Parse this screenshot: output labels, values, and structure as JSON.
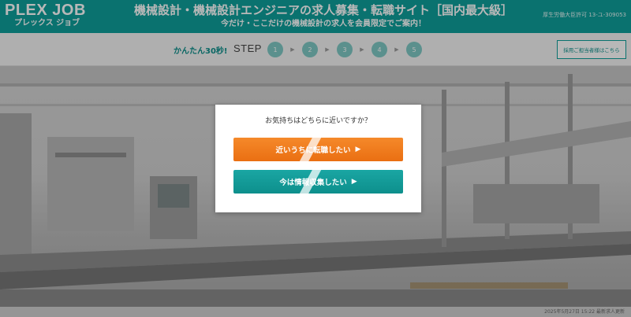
{
  "header": {
    "logo_main": "PLEX JOB",
    "logo_sub": "プレックス ジョブ",
    "title": "機械設計・機械設計エンジニアの求人募集・転職サイト［国内最大級］",
    "subtitle": "今だけ・ここだけの機械設計の求人を会員限定でご案内！",
    "license": "厚生労働大臣許可 13-ユ-309053"
  },
  "stepbar": {
    "lead": "かんたん30秒!",
    "label": "STEP",
    "steps": [
      "1",
      "2",
      "3",
      "4",
      "5"
    ],
    "corporate_button": "採用ご担当者様はこちら"
  },
  "modal": {
    "question": "お気持ちはどちらに近いですか？",
    "option_a": "近いうちに転職したい",
    "option_b": "今は情報収集したい",
    "arrow_glyph": "▶"
  },
  "footer": {
    "note": "2025年5月27日 15:22 最新求人更新"
  },
  "colors": {
    "brand": "#0e9e9a",
    "orange": "#ef7b1b",
    "teal_button": "#13a09c"
  }
}
